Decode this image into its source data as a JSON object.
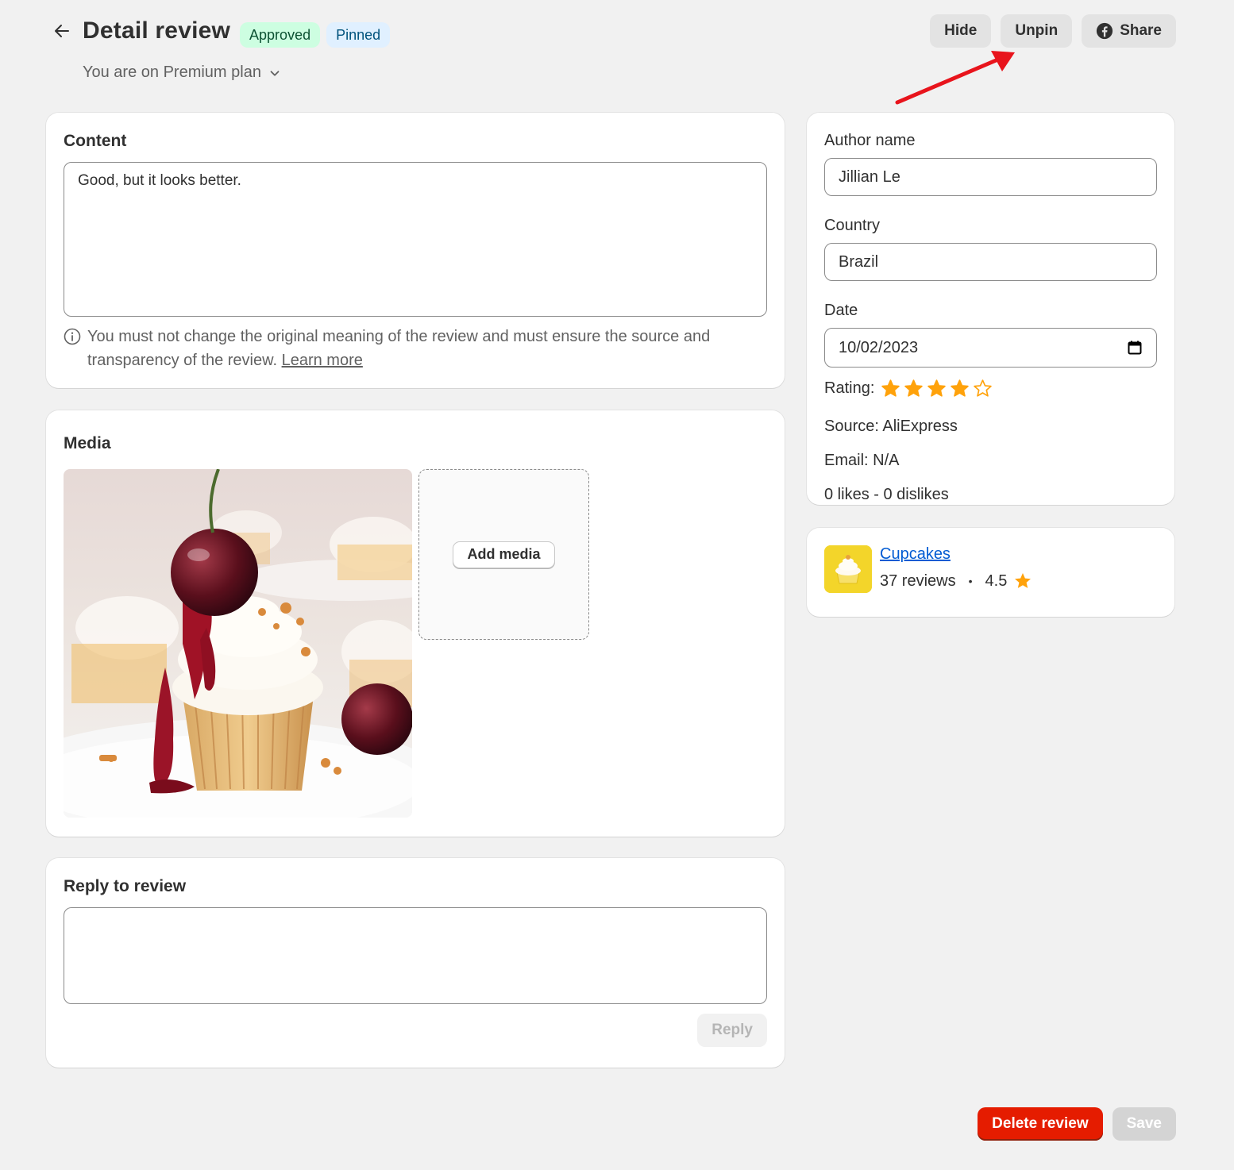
{
  "header": {
    "title": "Detail review",
    "badges": {
      "approved": "Approved",
      "pinned": "Pinned"
    },
    "plan": "You are on Premium plan",
    "actions": {
      "hide": "Hide",
      "unpin": "Unpin",
      "share": "Share"
    }
  },
  "content": {
    "title": "Content",
    "text": "Good, but it looks better.",
    "notice": "You must not change the original meaning of the review and must ensure the source and transparency of the review.",
    "learn_more": "Learn more"
  },
  "media": {
    "title": "Media",
    "add_media": "Add media"
  },
  "reply": {
    "title": "Reply to review",
    "button": "Reply"
  },
  "info": {
    "author_label": "Author name",
    "author_value": "Jillian Le",
    "country_label": "Country",
    "country_value": "Brazil",
    "date_label": "Date",
    "date_value": "10/02/2023",
    "rating_label": "Rating:",
    "rating": 4,
    "rating_max": 5,
    "source": "Source: AliExpress",
    "email": "Email: N/A",
    "likes": "0 likes - 0 dislikes"
  },
  "product": {
    "name": "Cupcakes",
    "reviews": "37 reviews",
    "separator": "•",
    "score": "4.5"
  },
  "footer": {
    "delete": "Delete review",
    "save": "Save"
  },
  "colors": {
    "star": "#ffa20b",
    "danger": "#e51c00",
    "annotation_arrow": "#e8141c"
  }
}
